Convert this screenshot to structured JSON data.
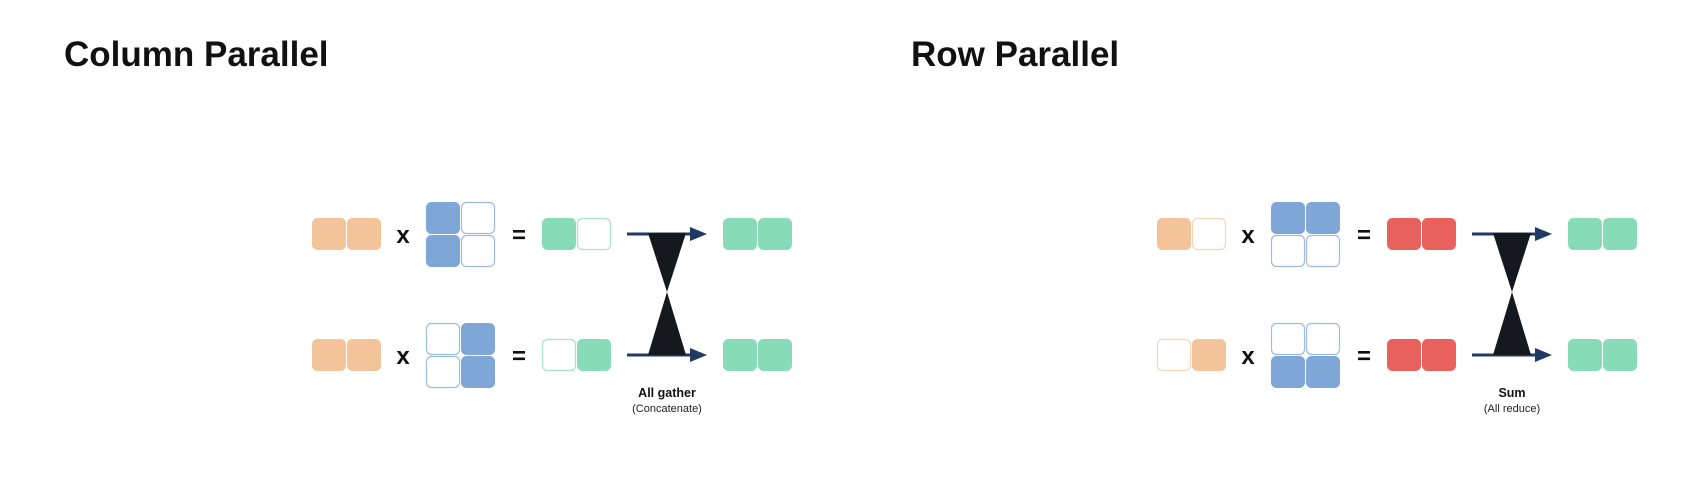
{
  "colors": {
    "orange": "#f3c39a",
    "orange_outline": "#f6d6bb",
    "blue": "#7ea7d8",
    "blue_outline": "#9dbbe3",
    "green": "#88dbb8",
    "green_outline": "#a6e3c8",
    "red": "#e8615d",
    "arrow": "#1f3a63",
    "hourglass": "#15181d"
  },
  "sections": [
    {
      "title": "Column Parallel",
      "rows": [
        {
          "input": [
            1,
            1
          ],
          "weight": [
            [
              1,
              0
            ],
            [
              1,
              0
            ]
          ],
          "partial": [
            1,
            0
          ],
          "partial_color": "green",
          "output": [
            1,
            1
          ]
        },
        {
          "input": [
            1,
            1
          ],
          "weight": [
            [
              0,
              1
            ],
            [
              0,
              1
            ]
          ],
          "partial": [
            0,
            1
          ],
          "partial_color": "green",
          "output": [
            1,
            1
          ]
        }
      ],
      "operator_mul": "x",
      "operator_eq": "=",
      "operation": {
        "label": "All gather",
        "sublabel": "(Concatenate)"
      }
    },
    {
      "title": "Row Parallel",
      "rows": [
        {
          "input": [
            1,
            0
          ],
          "weight": [
            [
              1,
              1
            ],
            [
              0,
              0
            ]
          ],
          "partial": [
            1,
            1
          ],
          "partial_color": "red",
          "output": [
            1,
            1
          ]
        },
        {
          "input": [
            0,
            1
          ],
          "weight": [
            [
              0,
              0
            ],
            [
              1,
              1
            ]
          ],
          "partial": [
            1,
            1
          ],
          "partial_color": "red",
          "output": [
            1,
            1
          ]
        }
      ],
      "operator_mul": "x",
      "operator_eq": "=",
      "operation": {
        "label": "Sum",
        "sublabel": "(All reduce)"
      }
    }
  ]
}
